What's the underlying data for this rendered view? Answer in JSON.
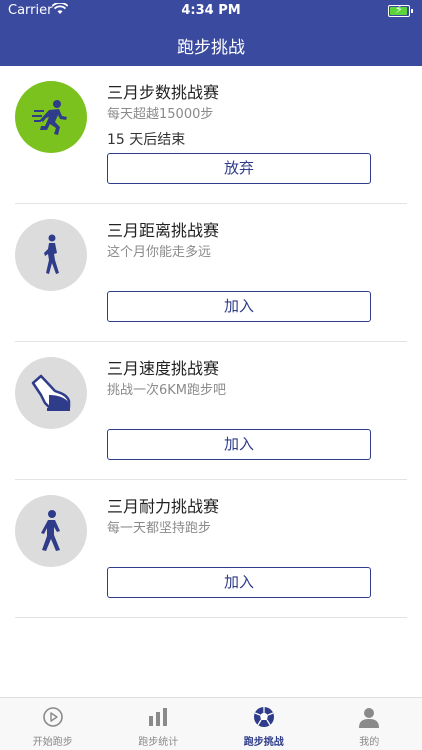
{
  "status_bar": {
    "carrier": "Carrier",
    "time": "4:34 PM"
  },
  "nav": {
    "title": "跑步挑战"
  },
  "challenges": [
    {
      "name": "三月步数挑战赛",
      "desc": "每天超越15000步",
      "ends": "15  天后结束",
      "button": "放弃",
      "icon": "running-man-icon"
    },
    {
      "name": "三月距离挑战赛",
      "desc": "这个月你能走多远",
      "button": "加入",
      "icon": "jogger-icon"
    },
    {
      "name": "三月速度挑战赛",
      "desc": "挑战一次6KM跑步吧",
      "button": "加入",
      "icon": "running-shoe-icon"
    },
    {
      "name": "三月耐力挑战赛",
      "desc": "每一天都坚持跑步",
      "button": "加入",
      "icon": "walker-icon"
    }
  ],
  "tabs": [
    {
      "label": "开始跑步",
      "icon": "play-icon"
    },
    {
      "label": "跑步统计",
      "icon": "bar-chart-icon"
    },
    {
      "label": "跑步挑战",
      "icon": "ball-icon",
      "active": true
    },
    {
      "label": "我的",
      "icon": "person-icon"
    }
  ],
  "colors": {
    "primary": "#3a4a9f",
    "accent_green": "#7cc21f",
    "avatar_gray": "#dcdcdc"
  }
}
